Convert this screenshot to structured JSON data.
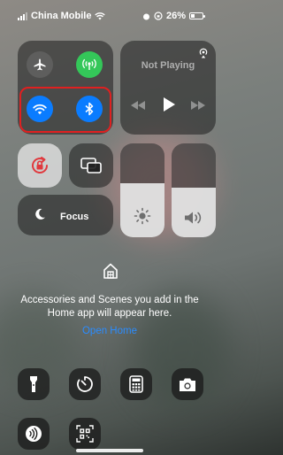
{
  "status_bar": {
    "carrier": "China Mobile",
    "battery_text": "26%",
    "battery_level": 0.26
  },
  "connectivity": {
    "airplane": "airplane-icon",
    "cellular": "cellular-antenna-icon",
    "wifi": "wifi-icon",
    "bluetooth": "bluetooth-icon"
  },
  "now_playing": {
    "title": "Not Playing"
  },
  "focus": {
    "label": "Focus"
  },
  "sliders": {
    "brightness_level": 0.58,
    "volume_level": 0.53
  },
  "home": {
    "message": "Accessories and Scenes you add in the Home app will appear here.",
    "link": "Open Home"
  },
  "colors": {
    "accent_blue": "#0a7cff",
    "cellular_green": "#34c759",
    "rotation_lock_red": "#e0393e",
    "highlight_red": "#e02020",
    "link_blue": "#2a8cff"
  }
}
